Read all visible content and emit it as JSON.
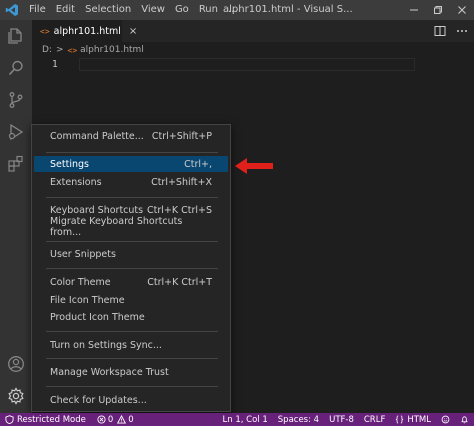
{
  "titlebar": {
    "menu": [
      "File",
      "Edit",
      "Selection",
      "View",
      "Go",
      "Run",
      "..."
    ],
    "window_title": "alphr101.html - Visual S..."
  },
  "tab": {
    "icon": "<>",
    "label": "alphr101.html",
    "close": "×"
  },
  "breadcrumb": {
    "drive": "D:",
    "sep": ">",
    "icon": "<>",
    "file": "alphr101.html"
  },
  "editor": {
    "line_number": "1"
  },
  "context_menu": {
    "items": [
      {
        "label": "Command Palette...",
        "shortcut": "Ctrl+Shift+P"
      },
      {
        "label": "Settings",
        "shortcut": "Ctrl+,"
      },
      {
        "label": "Extensions",
        "shortcut": "Ctrl+Shift+X"
      },
      {
        "label": "Keyboard Shortcuts",
        "shortcut": "Ctrl+K Ctrl+S"
      },
      {
        "label": "Migrate Keyboard Shortcuts from...",
        "shortcut": ""
      },
      {
        "label": "User Snippets",
        "shortcut": ""
      },
      {
        "label": "Color Theme",
        "shortcut": "Ctrl+K Ctrl+T"
      },
      {
        "label": "File Icon Theme",
        "shortcut": ""
      },
      {
        "label": "Product Icon Theme",
        "shortcut": ""
      },
      {
        "label": "Turn on Settings Sync...",
        "shortcut": ""
      },
      {
        "label": "Manage Workspace Trust",
        "shortcut": ""
      },
      {
        "label": "Check for Updates...",
        "shortcut": ""
      }
    ]
  },
  "statusbar": {
    "restricted_mode": "Restricted Mode",
    "errors": "0",
    "warnings": "0",
    "position": "Ln 1, Col 1",
    "spaces": "Spaces: 4",
    "encoding": "UTF-8",
    "eol": "CRLF",
    "language": "HTML"
  },
  "colors": {
    "statusbar": "#68217a",
    "menu_highlight": "#094771",
    "arrow": "#e0201a"
  }
}
